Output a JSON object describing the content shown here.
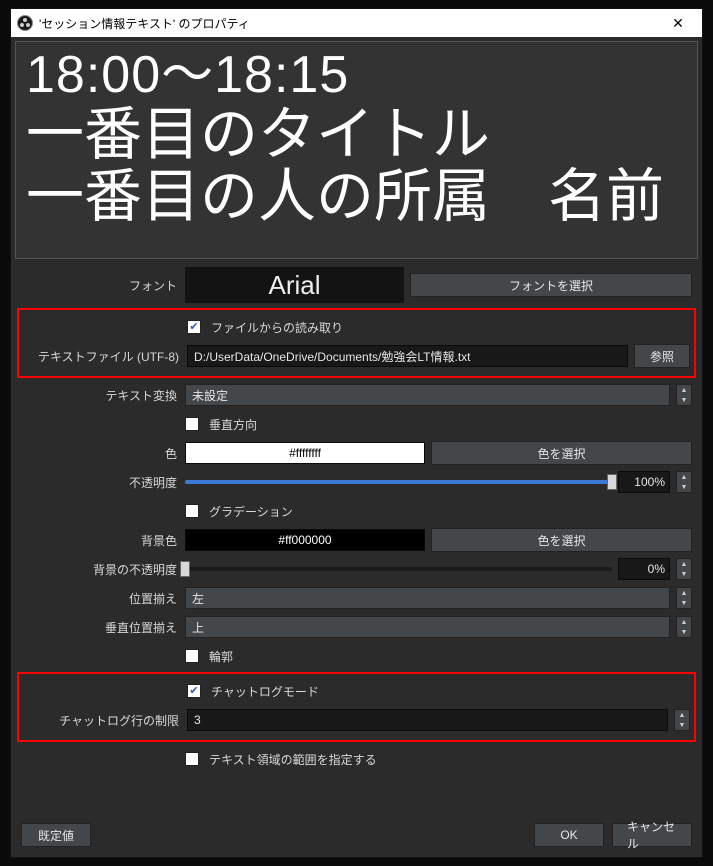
{
  "window": {
    "title": "'セッション情報テキスト' のプロパティ"
  },
  "preview": {
    "line1": "18:00～18:15",
    "line2": "一番目のタイトル",
    "line3": "一番目の人の所属　名前"
  },
  "labels": {
    "font": "フォント",
    "select_font": "フォントを選択",
    "read_from_file": "ファイルからの読み取り",
    "text_file": "テキストファイル (UTF-8)",
    "browse": "参照",
    "text_transform": "テキスト変換",
    "vertical": "垂直方向",
    "color": "色",
    "select_color": "色を選択",
    "opacity": "不透明度",
    "gradient": "グラデーション",
    "bg_color": "背景色",
    "bg_opacity": "背景の不透明度",
    "align": "位置揃え",
    "valign": "垂直位置揃え",
    "outline": "輪郭",
    "chatlog_mode": "チャットログモード",
    "chatlog_limit": "チャットログ行の制限",
    "specify_extents": "テキスト領域の範囲を指定する",
    "defaults": "既定値",
    "ok": "OK",
    "cancel": "キャンセル"
  },
  "values": {
    "font_name": "Arial",
    "file_path": "D:/UserData/OneDrive/Documents/勉強会LT情報.txt",
    "transform": "未設定",
    "color_hex": "#ffffffff",
    "opacity_pct": "100%",
    "bg_color_hex": "#ff000000",
    "bg_opacity_pct": "0%",
    "align": "左",
    "valign": "上",
    "chatlog_lines": "3"
  }
}
